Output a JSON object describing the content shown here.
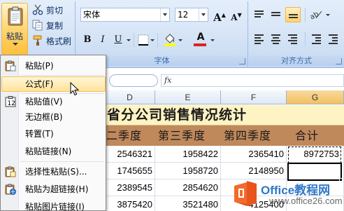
{
  "ribbon": {
    "clipboard": {
      "paste_label": "粘贴",
      "cut_label": "剪切",
      "copy_label": "复制",
      "format_painter_label": "格式刷"
    },
    "font": {
      "group_label": "字体",
      "font_name": "宋体",
      "font_size": "12",
      "grow_label": "A",
      "shrink_label": "A",
      "bold_label": "B",
      "italic_label": "I",
      "underline_label": "U",
      "font_color_label": "A",
      "fill_color": "#ffff00",
      "font_color": "#e02020"
    },
    "alignment": {
      "group_label": "对齐方式"
    }
  },
  "formula_bar": {
    "fx_label": "fx"
  },
  "sheet": {
    "columns": [
      "D",
      "E",
      "F",
      "G"
    ],
    "selected_column": "G",
    "title": "省分公司销售情况统计",
    "headers": [
      "二季度",
      "第三季度",
      "第四季度",
      "合计"
    ],
    "rows": [
      [
        "2546321",
        "1958422",
        "2365410",
        "8972753"
      ],
      [
        "1745655",
        "1958720",
        "2148950",
        ""
      ],
      [
        "2389545",
        "2854620",
        "",
        ""
      ],
      [
        "3875420",
        "3521480",
        "4125400",
        ""
      ]
    ]
  },
  "paste_menu": {
    "items": [
      {
        "label": "粘贴(P)",
        "icon": "paste-icon"
      },
      {
        "label": "公式(F)",
        "icon": ""
      },
      {
        "label": "粘贴值(V)",
        "icon": "paste-values-icon"
      },
      {
        "label": "无边框(B)",
        "icon": ""
      },
      {
        "label": "转置(T)",
        "icon": ""
      },
      {
        "label": "粘贴链接(N)",
        "icon": ""
      },
      {
        "label": "选择性粘贴(S)...",
        "icon": "paste-special-icon"
      },
      {
        "label": "粘贴为超链接(H)",
        "icon": "paste-hyperlink-icon"
      },
      {
        "label": "粘贴图片链接(I)",
        "icon": ""
      }
    ],
    "hovered_index": 1
  },
  "watermark": {
    "line1": "Office教程网",
    "line2": "www.office26.com"
  }
}
